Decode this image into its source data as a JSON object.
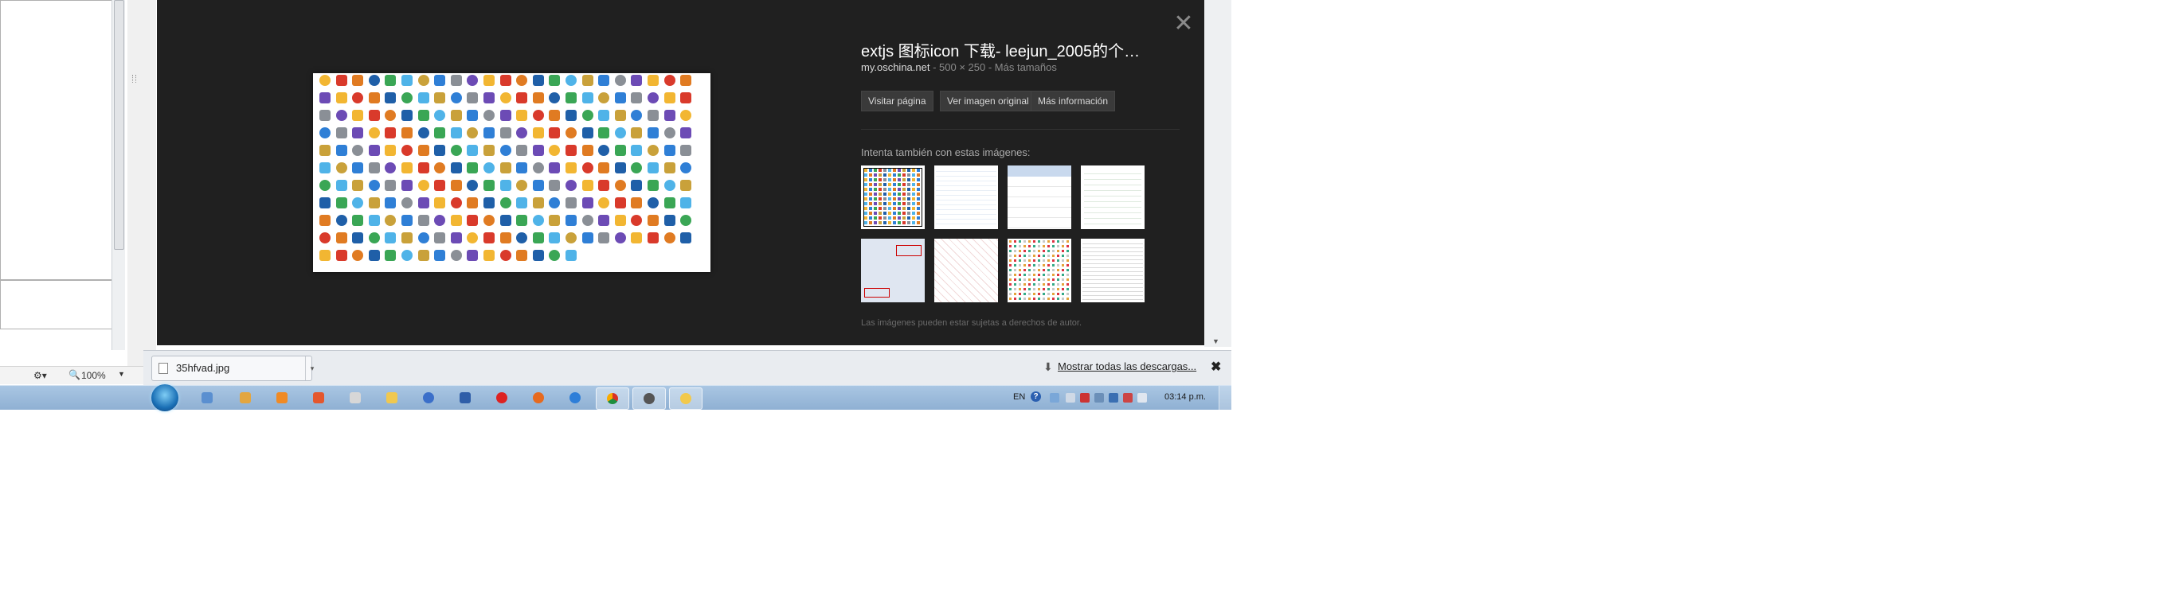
{
  "viewer": {
    "title": "extjs 图标icon 下载- leejun_2005的个…",
    "source_domain": "my.oschina.net",
    "source_meta": "- 500 × 250 - Más tamaños",
    "buttons": {
      "visit": "Visitar página",
      "original": "Ver imagen original",
      "more": "Más información"
    },
    "also_label": "Intenta también con estas imágenes:",
    "rights_note": "Las imágenes pueden estar sujetas a derechos de autor.",
    "close_glyph": "✕"
  },
  "status_left": {
    "zoom": "100%"
  },
  "downloads": {
    "file_name": "35hfvad.jpg",
    "show_all": "Mostrar todas las descargas...",
    "close_glyph": "✖"
  },
  "taskbar": {
    "language": "EN",
    "clock": "03:14 p.m."
  },
  "colors": {
    "viewer_bg": "#202020",
    "taskbar": "#9ebcdc"
  }
}
